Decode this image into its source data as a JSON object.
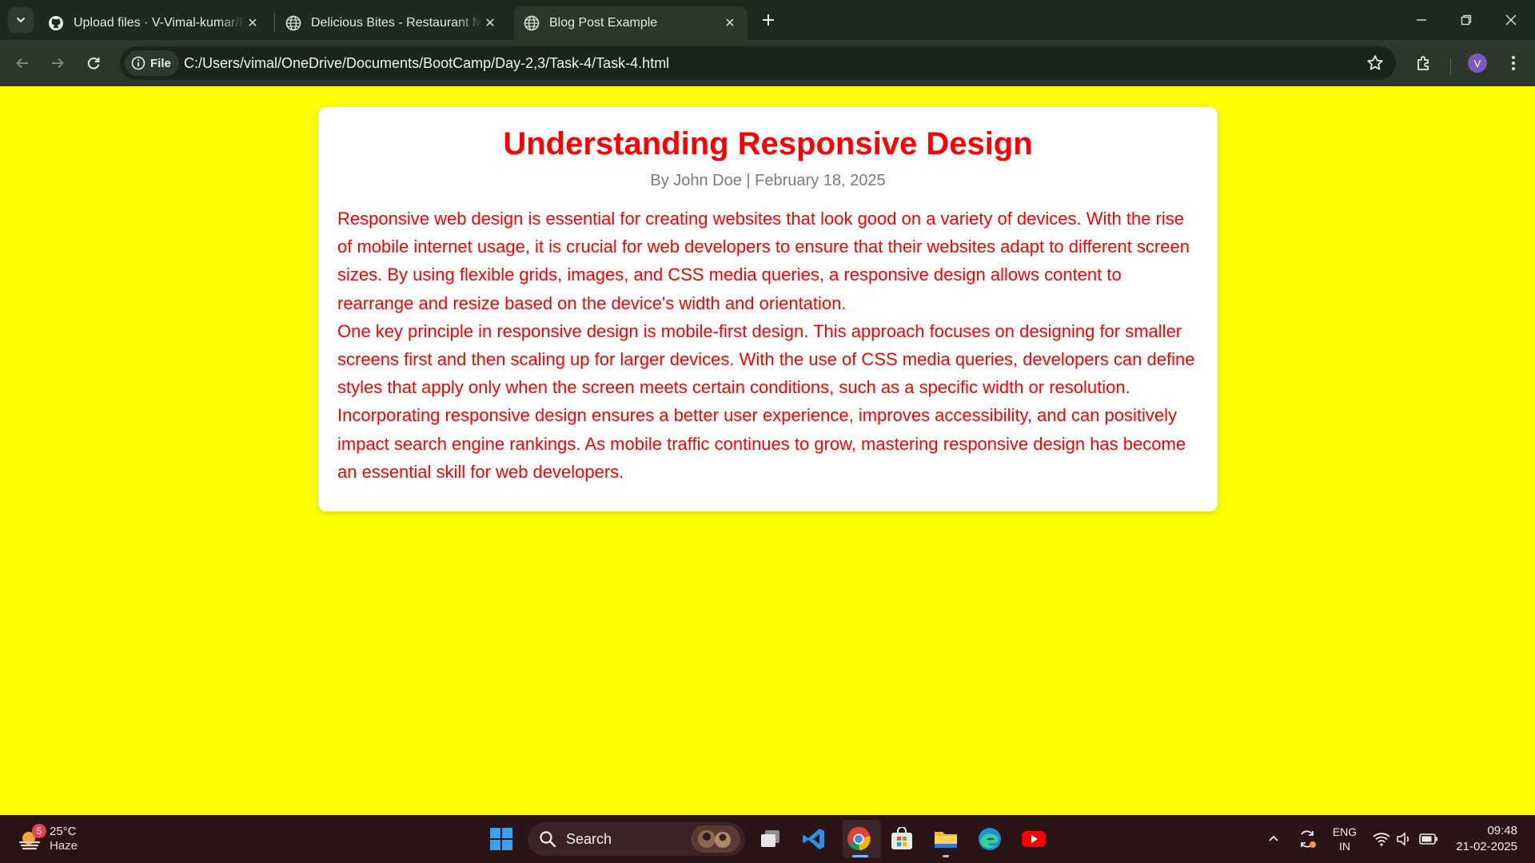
{
  "browser": {
    "tabs": [
      {
        "title": "Upload files · V-Vimal-kumar/Bo",
        "favicon": "github-icon",
        "active": false
      },
      {
        "title": "Delicious Bites - Restaurant Men",
        "favicon": "globe-icon",
        "active": false
      },
      {
        "title": "Blog Post Example",
        "favicon": "globe-icon",
        "active": true
      }
    ],
    "address": {
      "scheme_chip": "File",
      "url": "C:/Users/vimal/OneDrive/Documents/BootCamp/Day-2,3/Task-4/Task-4.html"
    },
    "profile_initial": "V"
  },
  "page": {
    "background_color": "#ffff00",
    "title": "Understanding Responsive Design",
    "meta": "By John Doe | February 18, 2025",
    "paragraphs": [
      "Responsive web design is essential for creating websites that look good on a variety of devices. With the rise of mobile internet usage, it is crucial for web developers to ensure that their websites adapt to different screen sizes. By using flexible grids, images, and CSS media queries, a responsive design allows content to rearrange and resize based on the device's width and orientation.",
      "One key principle in responsive design is mobile-first design. This approach focuses on designing for smaller screens first and then scaling up for larger devices. With the use of CSS media queries, developers can define styles that apply only when the screen meets certain conditions, such as a specific width or resolution.",
      "Incorporating responsive design ensures a better user experience, improves accessibility, and can positively impact search engine rankings. As mobile traffic continues to grow, mastering responsive design has become an essential skill for web developers."
    ],
    "accent_color": "#ff0000"
  },
  "taskbar": {
    "weather": {
      "badge": "5",
      "temp": "25°C",
      "condition": "Haze"
    },
    "search_label": "Search",
    "apps": [
      "windows-start-icon",
      "search-icon",
      "task-view-icon",
      "vscode-icon",
      "chrome-icon",
      "microsoft-store-icon",
      "file-explorer-icon",
      "edge-icon",
      "youtube-icon"
    ],
    "tray": {
      "language": "ENG",
      "region": "IN"
    },
    "clock": {
      "time": "09:48",
      "date": "21-02-2025"
    }
  }
}
